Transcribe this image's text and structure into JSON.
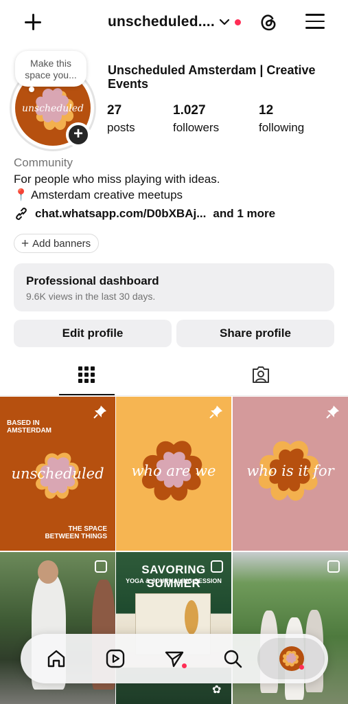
{
  "header": {
    "username": "unscheduled....",
    "has_notification": true
  },
  "profile": {
    "note_bubble": "Make this space you...",
    "display_name": "Unscheduled Amsterdam | Creative Events",
    "avatar_text": "unscheduled",
    "stats": [
      {
        "value": "27",
        "label": "posts"
      },
      {
        "value": "1.027",
        "label": "followers"
      },
      {
        "value": "12",
        "label": "following"
      }
    ],
    "category": "Community",
    "bio_line1": "For people who miss playing with ideas.",
    "bio_line2_icon": "📍",
    "bio_line2": " Amsterdam creative meetups",
    "link": "chat.whatsapp.com/D0bXBAj...",
    "link_more": "and 1 more",
    "add_banners": "Add banners"
  },
  "dashboard": {
    "title": "Professional dashboard",
    "subtitle": "9.6K views in the last 30 days."
  },
  "actions": {
    "edit": "Edit profile",
    "share": "Share profile"
  },
  "tabs": [
    {
      "icon": "grid-icon",
      "active": true
    },
    {
      "icon": "tagged-icon",
      "active": false
    }
  ],
  "posts": [
    {
      "top_text": "BASED IN\nAMSTERDAM",
      "caption": "unscheduled",
      "bottom_text": "THE SPACE\nBETWEEN THINGS",
      "pinned": true,
      "bg": "#b6500f"
    },
    {
      "caption": "who are we",
      "pinned": true,
      "bg": "#f6b552"
    },
    {
      "caption": "who is it for",
      "pinned": true,
      "bg": "#d49a9b"
    },
    {
      "type": "photo",
      "multi": true
    },
    {
      "type": "photo",
      "title": "SAVORING SUMMER",
      "subtitle": "YOGA & JOURNALING SESSION",
      "multi": true
    },
    {
      "type": "photo",
      "multi": true
    }
  ],
  "nav": {
    "items": [
      "home-icon",
      "reels-icon",
      "direct-icon",
      "search-icon",
      "profile-avatar"
    ],
    "active": "profile-avatar"
  },
  "colors": {
    "brand_orange": "#b6500f",
    "brand_yellow": "#f6b552",
    "brand_pink": "#d49a9b",
    "flower_pink": "#d9a6b3",
    "notification_red": "#ff2d55"
  }
}
